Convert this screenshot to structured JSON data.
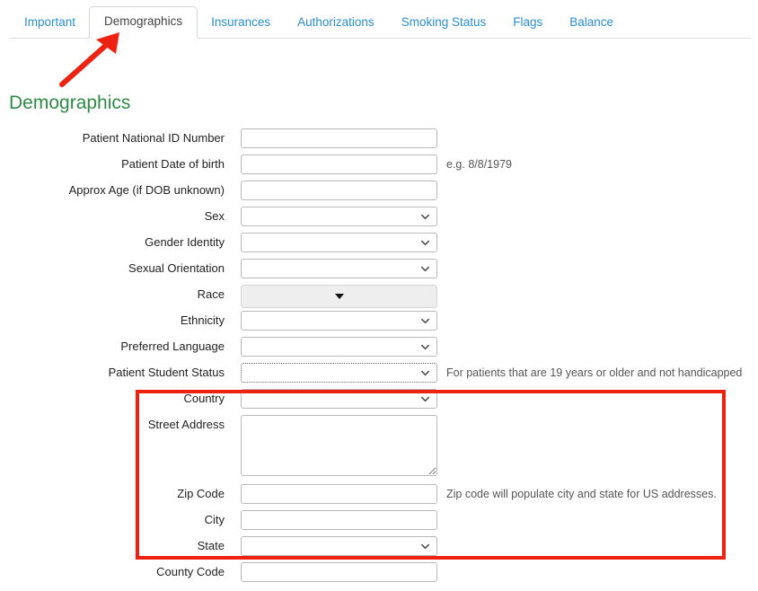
{
  "tabs": [
    {
      "label": "Important",
      "active": false
    },
    {
      "label": "Demographics",
      "active": true
    },
    {
      "label": "Insurances",
      "active": false
    },
    {
      "label": "Authorizations",
      "active": false
    },
    {
      "label": "Smoking Status",
      "active": false
    },
    {
      "label": "Flags",
      "active": false
    },
    {
      "label": "Balance",
      "active": false
    }
  ],
  "heading": "Demographics",
  "colors": {
    "tab_link": "#2a8fd4",
    "tab_active_text": "#444444",
    "heading_green": "#2e8b45",
    "annotation_red": "#ee2211",
    "race_field_bg": "#eeeeee"
  },
  "form": {
    "rows": [
      {
        "label": "Patient National ID Number",
        "type": "text",
        "value": "",
        "hint": ""
      },
      {
        "label": "Patient Date of birth",
        "type": "text",
        "value": "",
        "hint": "e.g. 8/8/1979"
      },
      {
        "label": "Approx Age (if DOB unknown)",
        "type": "text",
        "value": "",
        "hint": ""
      },
      {
        "label": "Sex",
        "type": "select",
        "value": "",
        "hint": ""
      },
      {
        "label": "Gender Identity",
        "type": "select",
        "value": "",
        "hint": ""
      },
      {
        "label": "Sexual Orientation",
        "type": "select",
        "value": "",
        "hint": ""
      },
      {
        "label": "Race",
        "type": "race-button",
        "value": "",
        "hint": ""
      },
      {
        "label": "Ethnicity",
        "type": "select",
        "value": "",
        "hint": ""
      },
      {
        "label": "Preferred Language",
        "type": "select",
        "value": "",
        "hint": ""
      },
      {
        "label": "Patient Student Status",
        "type": "select-focused",
        "value": "",
        "hint": "For patients that are 19 years or older and not handicapped"
      },
      {
        "label": "Country",
        "type": "select",
        "value": "",
        "hint": ""
      },
      {
        "label": "Street Address",
        "type": "textarea",
        "value": "",
        "hint": ""
      },
      {
        "label": "Zip Code",
        "type": "text",
        "value": "",
        "hint": "Zip code will populate city and state for US addresses."
      },
      {
        "label": "City",
        "type": "text",
        "value": "",
        "hint": ""
      },
      {
        "label": "State",
        "type": "select",
        "value": "",
        "hint": ""
      },
      {
        "label": "County Code",
        "type": "text",
        "value": "",
        "hint": ""
      }
    ]
  },
  "annotations": {
    "arrow": "red-arrow-pointing-to-demographics-tab",
    "highlight": "red-rectangle-around-address-fields"
  }
}
